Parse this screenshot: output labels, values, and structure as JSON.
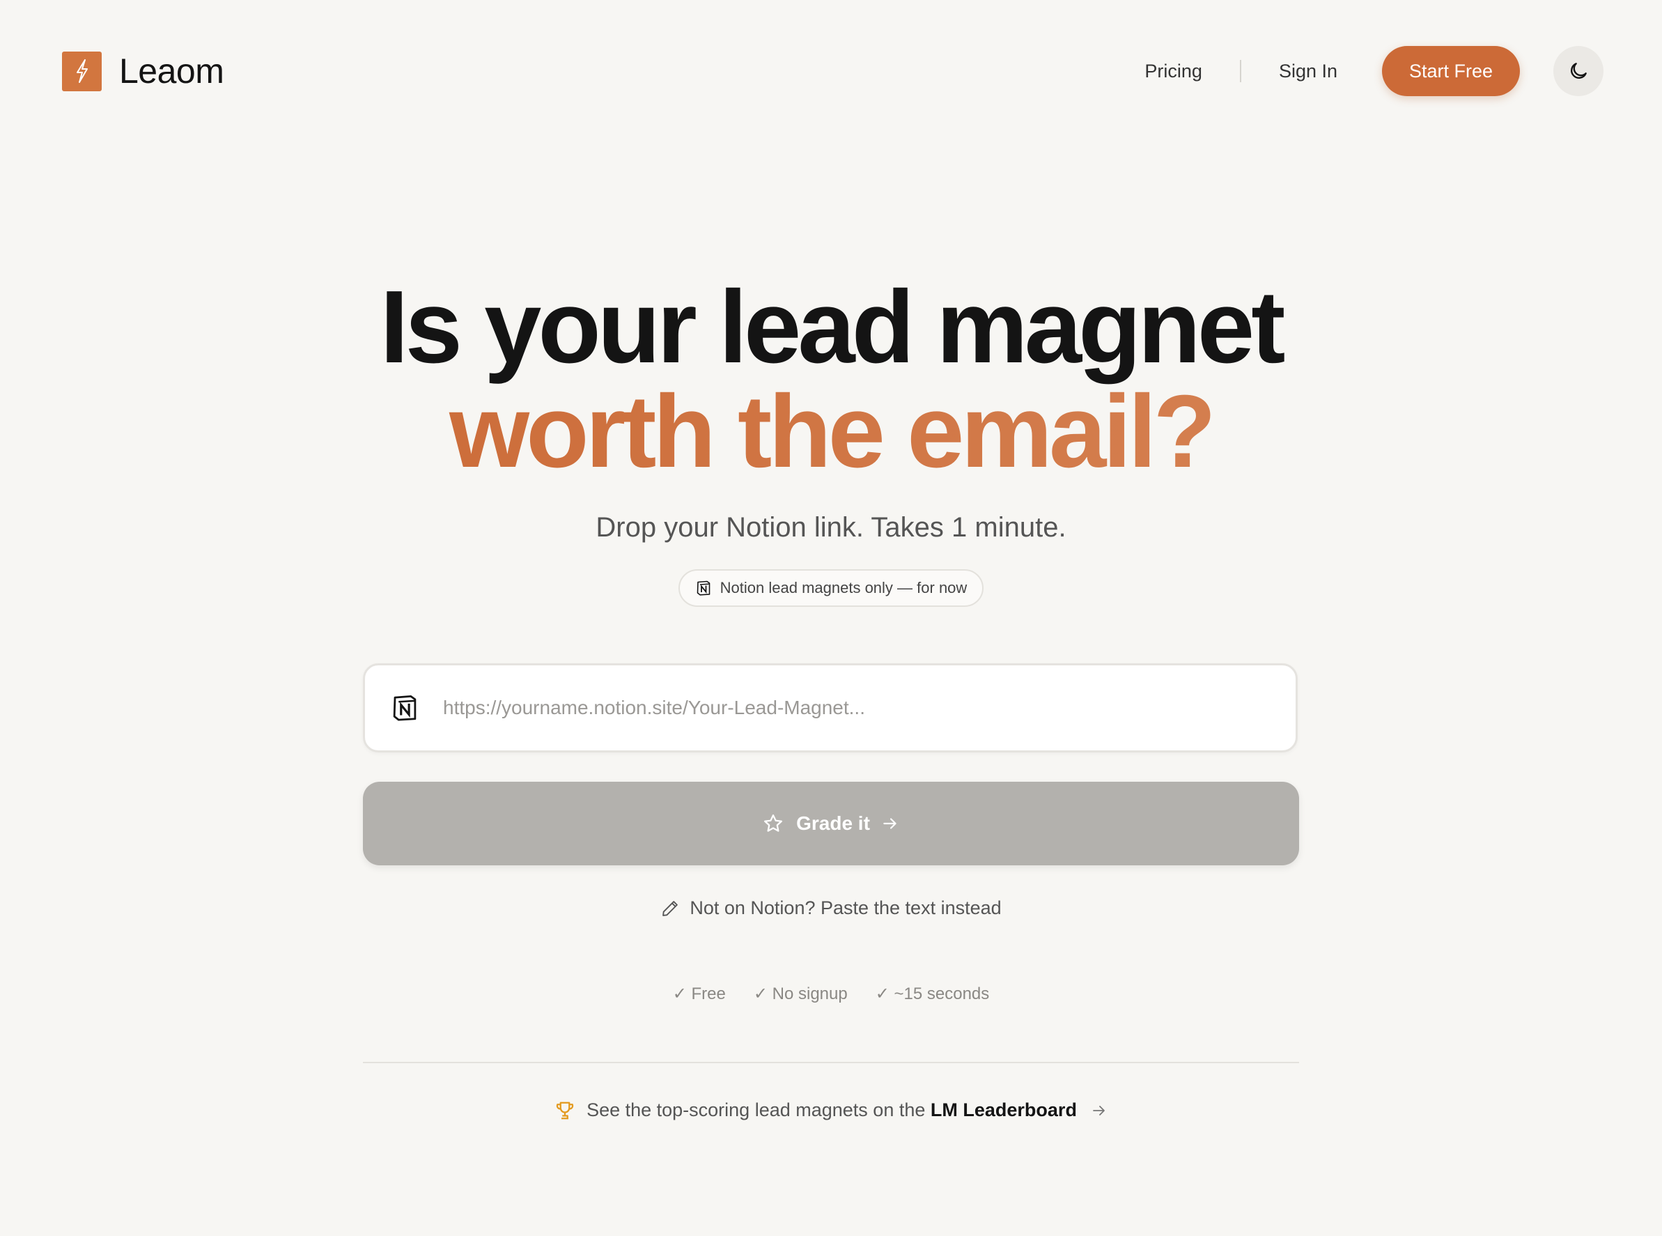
{
  "brand": {
    "name": "Leaom",
    "accent": "#cc6a37"
  },
  "nav": {
    "pricing": "Pricing",
    "sign_in": "Sign In",
    "start_free": "Start Free",
    "theme_icon": "moon-icon"
  },
  "hero": {
    "line1": "Is your lead magnet",
    "line2": "worth the email?",
    "subtitle": "Drop your Notion link. Takes 1 minute.",
    "badge": "Notion lead magnets only — for now"
  },
  "form": {
    "placeholder": "https://yourname.notion.site/Your-Lead-Magnet...",
    "value": "",
    "grade_label": "Grade it",
    "paste_link": "Not on Notion? Paste the text instead"
  },
  "checks": [
    "✓ Free",
    "✓ No signup",
    "✓ ~15 seconds"
  ],
  "leaderboard": {
    "prefix": "See the top-scoring lead magnets on the",
    "link": "LM Leaderboard"
  }
}
